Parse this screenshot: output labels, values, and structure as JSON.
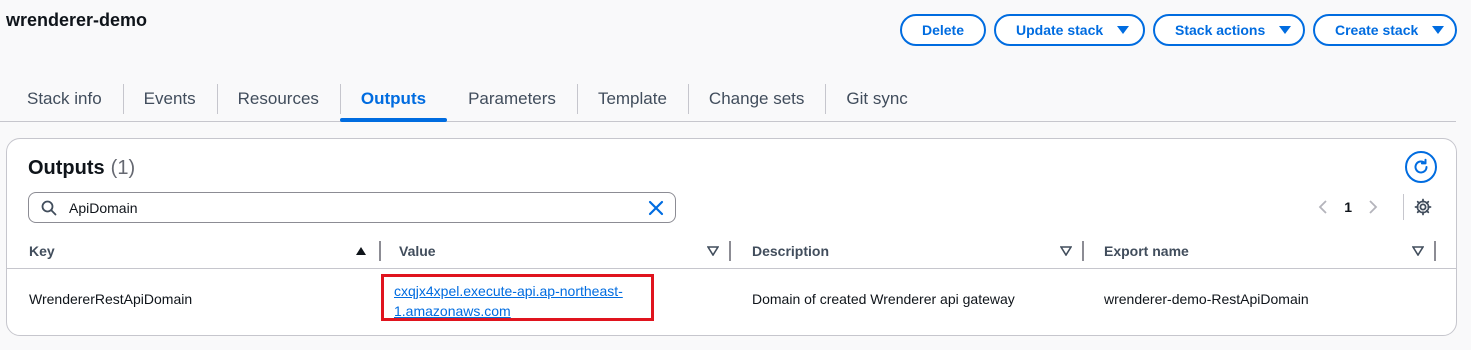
{
  "page": {
    "title": "wrenderer-demo"
  },
  "actions": {
    "delete": "Delete",
    "update": "Update stack",
    "stack_actions": "Stack actions",
    "create": "Create stack"
  },
  "tabs": [
    {
      "label": "Stack info",
      "active": false
    },
    {
      "label": "Events",
      "active": false
    },
    {
      "label": "Resources",
      "active": false
    },
    {
      "label": "Outputs",
      "active": true
    },
    {
      "label": "Parameters",
      "active": false
    },
    {
      "label": "Template",
      "active": false
    },
    {
      "label": "Change sets",
      "active": false
    },
    {
      "label": "Git sync",
      "active": false
    }
  ],
  "outputs": {
    "title": "Outputs",
    "count": "(1)",
    "search": {
      "value": "ApiDomain",
      "placeholder": ""
    },
    "page_number": "1",
    "columns": {
      "key": "Key",
      "value": "Value",
      "description": "Description",
      "export_name": "Export name"
    },
    "rows": [
      {
        "key": "WrendererRestApiDomain",
        "value_line1": "cxqjx4xpel.execute-api.ap-northeast-",
        "value_line2": "1.amazonaws.com",
        "description": "Domain of created Wrenderer api gateway",
        "export_name": "wrenderer-demo-RestApiDomain"
      }
    ]
  },
  "colors": {
    "accent": "#006ce0",
    "highlight": "#e0141e"
  }
}
